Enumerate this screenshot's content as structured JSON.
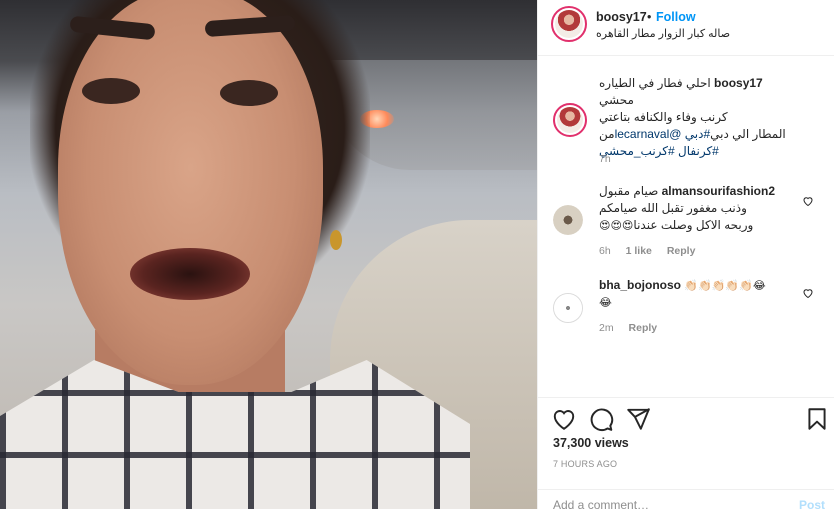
{
  "post": {
    "username": "boosy17",
    "follow_label": "Follow",
    "separator": "•",
    "location": "صاله كبار الزوار مطار القاهره"
  },
  "caption": {
    "username": "boosy17",
    "line1": "احلي فطار في الطياره محشي",
    "line2": "كرنب وفاء والكنافه بتاعتي",
    "line3_start": "المطار الي دبي",
    "hashtag_dubai": "#دبي",
    "mention": "@lecarnaval",
    "line3_end": "من",
    "hashtag_carnival": "#كرنفال",
    "hashtag_cabbage": "#كرنب_محشي",
    "time": "7h"
  },
  "comments": [
    {
      "username": "almansourifashion2",
      "text1": "صيام مقبول",
      "text2": "وذنب مغفور تقبل الله صيامكم",
      "text3": "وربحه الاكل وصلت عندنا",
      "emoji": "😍😍😍",
      "time": "6h",
      "likes": "1 like",
      "reply": "Reply"
    },
    {
      "username": "bha_bojonoso",
      "emoji_line1": "👏🏻👏🏻👏🏻👏🏻👏🏻😂",
      "emoji_line2": "😂",
      "time": "2m",
      "reply": "Reply"
    }
  ],
  "stats": {
    "views": "37,300 views",
    "time_ago": "7 HOURS AGO"
  },
  "add_comment": {
    "placeholder": "Add a comment…",
    "post_label": "Post"
  },
  "colors": {
    "accent_blue": "#0095f6",
    "muted": "#8e8e8e",
    "text": "#262626",
    "post_disabled": "#b2dffc",
    "story_ring": "#e1306c"
  },
  "icons": {
    "like": "heart-icon",
    "comment": "comment-icon",
    "share": "share-icon",
    "save": "bookmark-icon"
  }
}
